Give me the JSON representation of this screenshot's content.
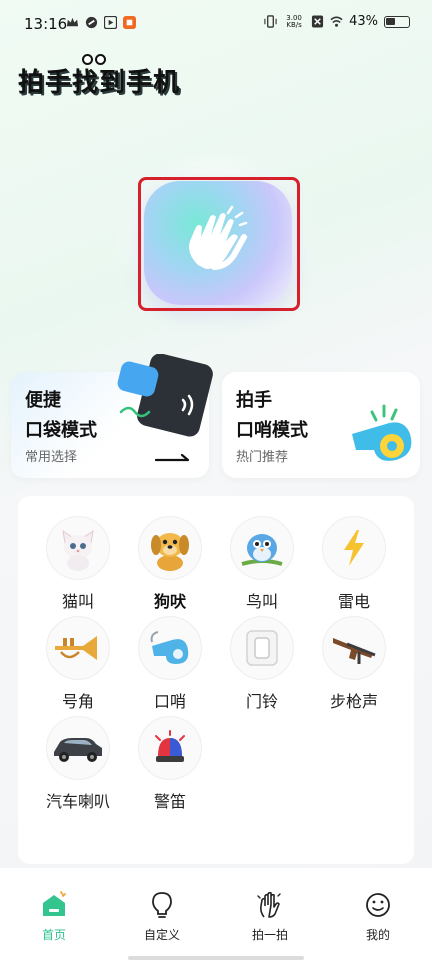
{
  "status_bar": {
    "time": "13:16",
    "net_speed_value": "3.00",
    "net_speed_unit": "KB/s",
    "battery": "43%",
    "battery_level": 0.43
  },
  "app": {
    "title": "拍手找到手机"
  },
  "clap_button": {
    "icon": "clapping-hands-icon"
  },
  "modes": [
    {
      "title_line1": "便捷",
      "title_line2": "口袋模式",
      "subtitle": "常用选择",
      "icon": "phone-in-pocket-icon"
    },
    {
      "title_line1": "拍手",
      "title_line2": "口哨模式",
      "subtitle": "热门推荐",
      "icon": "whistle-icon"
    }
  ],
  "sounds": [
    {
      "label": "猫叫",
      "icon": "cat-icon"
    },
    {
      "label": "狗吠",
      "icon": "dog-icon",
      "active": true
    },
    {
      "label": "鸟叫",
      "icon": "bird-icon"
    },
    {
      "label": "雷电",
      "icon": "lightning-icon"
    },
    {
      "label": "号角",
      "icon": "trumpet-icon"
    },
    {
      "label": "口哨",
      "icon": "whistle-icon"
    },
    {
      "label": "门铃",
      "icon": "doorbell-icon"
    },
    {
      "label": "步枪声",
      "icon": "rifle-icon"
    },
    {
      "label": "汽车喇叭",
      "icon": "car-icon"
    },
    {
      "label": "警笛",
      "icon": "siren-icon"
    }
  ],
  "nav": [
    {
      "label": "首页",
      "icon": "home-icon",
      "active": true
    },
    {
      "label": "自定义",
      "icon": "lightbulb-icon"
    },
    {
      "label": "拍一拍",
      "icon": "hand-icon"
    },
    {
      "label": "我的",
      "icon": "smiley-icon"
    }
  ],
  "colors": {
    "accent": "#2ec08d",
    "highlight_border": "#d6202c"
  }
}
